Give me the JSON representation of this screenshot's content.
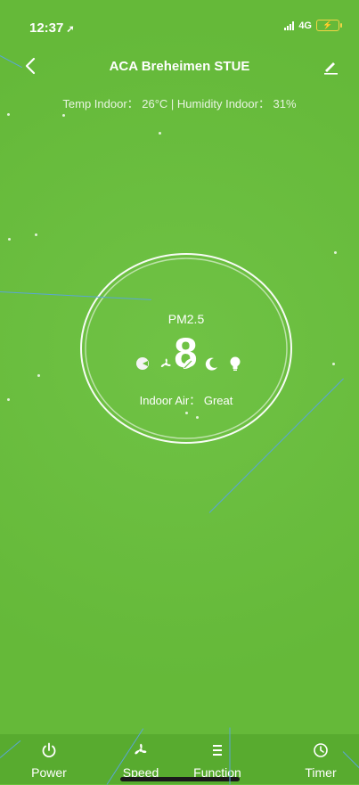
{
  "status_bar": {
    "time": "12:37",
    "network": "4G"
  },
  "header": {
    "title": "ACA Breheimen STUE"
  },
  "summary": "Temp Indoor： 26°C | Humidity Indoor： 31%",
  "gauge": {
    "label": "PM2.5",
    "value": "8",
    "air_quality": "Indoor Air： Great"
  },
  "modes": [
    "auto-mode-icon",
    "fan-icon",
    "leaf-icon",
    "moon-icon",
    "bulb-icon"
  ],
  "bottom_nav": [
    {
      "label": "Power",
      "icon": "power-icon"
    },
    {
      "label": "Speed",
      "icon": "fan-icon"
    },
    {
      "label": "Function",
      "icon": "menu-icon"
    },
    {
      "label": "Timer",
      "icon": "clock-icon"
    }
  ],
  "colors": {
    "background": "#68bf3b",
    "bottom_bar": "#58ab2f",
    "battery": "#f2d545"
  }
}
